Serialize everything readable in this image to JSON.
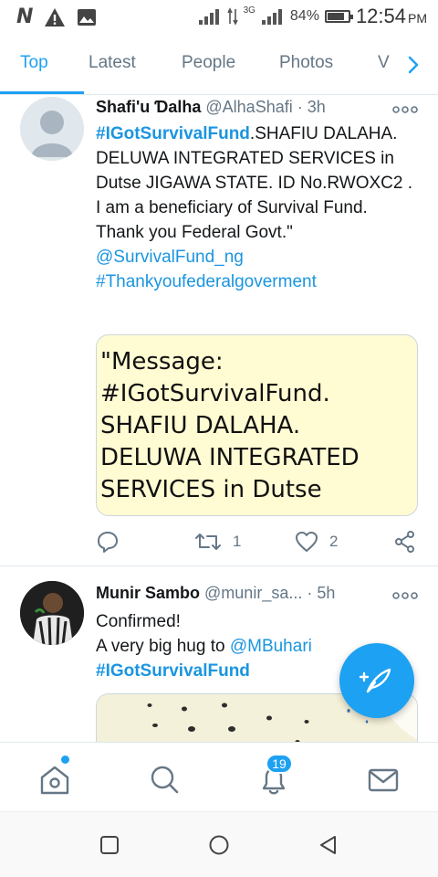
{
  "status_bar": {
    "network_3g": "3G",
    "battery_pct": "84%",
    "battery_level": 0.84,
    "time": "12:54",
    "ampm": "PM"
  },
  "tabs": [
    {
      "label": "Top",
      "active": true
    },
    {
      "label": "Latest"
    },
    {
      "label": "People"
    },
    {
      "label": "Photos"
    },
    {
      "label": "V"
    }
  ],
  "tweets": [
    {
      "name": "Shafi'u Ɗalha",
      "handle": "@AlhaShafi",
      "time": "· 3h",
      "body_hashtag": "#IGotSurvivalFund",
      "body_text": ".SHAFIU DALAHA. DELUWA INTEGRATED SERVICES in Dutse JIGAWA STATE. ID No.RWOXC2 . I am a beneficiary of Survival Fund. Thank you Federal Govt.\"",
      "mention": "@SurvivalFund_ng",
      "hashtag2": "#Thankyoufederalgoverment",
      "media_text": "\"Message:\n#IGotSurvivalFund.\nSHAFIU DALAHA.\nDELUWA INTEGRATED\nSERVICES in Dutse",
      "replies": "",
      "retweets": "1",
      "likes": "2"
    },
    {
      "name": "Munir Sambo",
      "handle": "@munir_sa...",
      "time": "· 5h",
      "line1": "Confirmed!",
      "line2_text": "A very big hug to ",
      "mention": "@MBuhari",
      "hashtag": "#IGotSurvivalFund"
    }
  ],
  "bottom_nav": {
    "notifications_count": "19"
  },
  "colors": {
    "accent": "#1da1f2",
    "link": "#1b95e0",
    "muted": "#657786"
  }
}
